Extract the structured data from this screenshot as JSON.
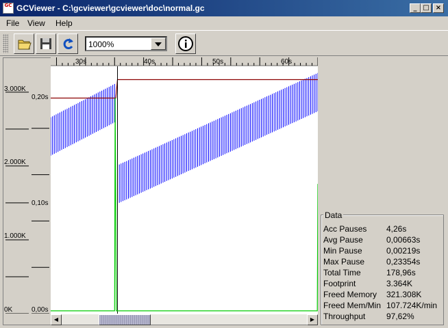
{
  "window": {
    "title": "GCViewer - C:\\gcviewer\\gcviewer\\doc\\normal.gc",
    "app_icon_text": "GC"
  },
  "menu": [
    {
      "label": "File"
    },
    {
      "label": "View"
    },
    {
      "label": "Help"
    }
  ],
  "toolbar": {
    "zoom_value": "1000%",
    "icons": [
      "open-folder-icon",
      "save-icon",
      "refresh-icon",
      "info-icon"
    ]
  },
  "chart": {
    "time_ticks": [
      "30s",
      "40s",
      "50s",
      "60s"
    ],
    "memory_ticks": [
      "3.000K",
      "2.000K",
      "1.000K",
      "0K"
    ],
    "pause_ticks": [
      "0,20s",
      "0,10s",
      "0,00s"
    ],
    "colors": {
      "heap": "#0000ff",
      "pause": "#00cc00",
      "total": "#8b0000"
    }
  },
  "chart_data": {
    "type": "line",
    "title": "",
    "xlabel": "",
    "ylabel": "",
    "xlim": [
      19,
      65
    ],
    "series": [
      {
        "axis": "memory",
        "x": [
          19,
          30,
          30.5,
          65
        ],
        "values": [
          2400,
          2850,
          1750,
          3000
        ]
      },
      {
        "axis": "memory",
        "x": [
          19,
          30.2,
          30.5,
          65
        ],
        "values": [
          2920,
          2920,
          3170,
          3170
        ]
      },
      {
        "axis": "pause",
        "x": [
          19,
          30,
          30.1,
          30.3,
          64.9,
          65
        ],
        "values": [
          0.003,
          0.003,
          0.233,
          0.003,
          0.003,
          0.14
        ]
      }
    ]
  },
  "data_panel": {
    "title": "Data",
    "rows": [
      {
        "key": "Acc Pauses",
        "value": "4,26s"
      },
      {
        "key": "Avg Pause",
        "value": "0,00663s"
      },
      {
        "key": "Min Pause",
        "value": "0,00219s"
      },
      {
        "key": "Max Pause",
        "value": "0,23354s"
      },
      {
        "key": "Total Time",
        "value": "178,96s"
      },
      {
        "key": "Footprint",
        "value": "3.364K"
      },
      {
        "key": "Freed Memory",
        "value": "321.308K"
      },
      {
        "key": "Freed Mem/Min",
        "value": "107.724K/min"
      },
      {
        "key": "Throughput",
        "value": "97,62%"
      }
    ]
  }
}
